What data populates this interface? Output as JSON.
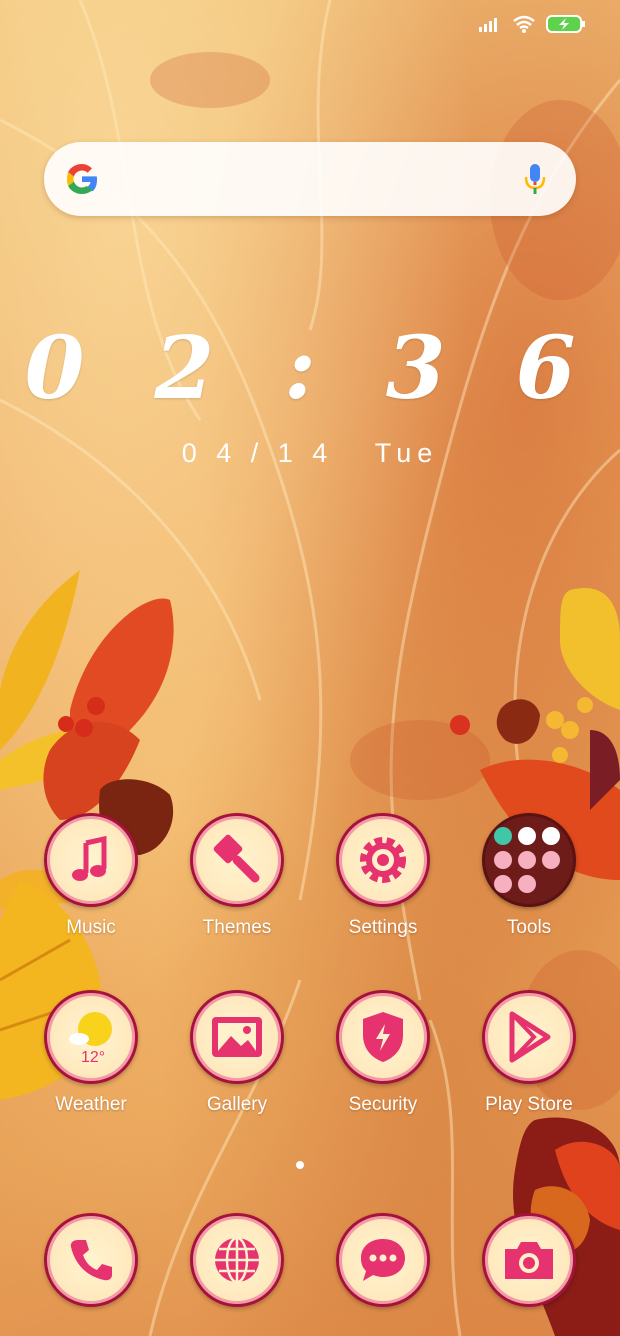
{
  "status_bar": {
    "signal_icon": "signal-icon",
    "wifi_icon": "wifi-icon",
    "battery_icon": "battery-charging-icon"
  },
  "search_bar": {
    "logo": "google-logo",
    "mic_icon": "mic-icon"
  },
  "clock": {
    "time": "0 2 : 3 6",
    "date": "0 4 / 1 4",
    "day": "Tue"
  },
  "apps_row1": [
    {
      "label": "Music",
      "icon": "music-note-icon"
    },
    {
      "label": "Themes",
      "icon": "paintbrush-icon"
    },
    {
      "label": "Settings",
      "icon": "gear-icon"
    },
    {
      "label": "Tools",
      "icon": "folder-icon"
    }
  ],
  "apps_row2": [
    {
      "label": "Weather",
      "icon": "weather-sun-icon",
      "temp": "12°"
    },
    {
      "label": "Gallery",
      "icon": "image-icon"
    },
    {
      "label": "Security",
      "icon": "shield-icon"
    },
    {
      "label": "Play Store",
      "icon": "play-icon"
    }
  ],
  "dock": [
    {
      "icon": "phone-icon"
    },
    {
      "icon": "browser-globe-icon"
    },
    {
      "icon": "message-icon"
    },
    {
      "icon": "camera-icon"
    }
  ],
  "colors": {
    "icon_pink": "#e6326e",
    "icon_border": "#a7123c",
    "icon_bg": "#fff1cc"
  }
}
